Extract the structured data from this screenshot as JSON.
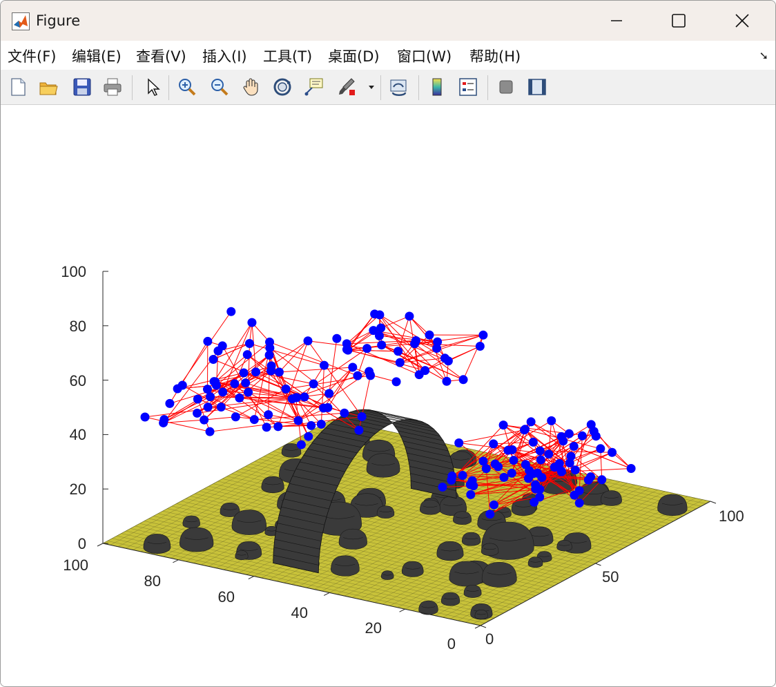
{
  "window": {
    "title": "Figure"
  },
  "menu": [
    {
      "label": "文件(F)",
      "name": "menu-file"
    },
    {
      "label": "编辑(E)",
      "name": "menu-edit"
    },
    {
      "label": "查看(V)",
      "name": "menu-view"
    },
    {
      "label": "插入(I)",
      "name": "menu-insert"
    },
    {
      "label": "工具(T)",
      "name": "menu-tools"
    },
    {
      "label": "桌面(D)",
      "name": "menu-desktop"
    },
    {
      "label": "窗口(W)",
      "name": "menu-window"
    },
    {
      "label": "帮助(H)",
      "name": "menu-help"
    }
  ],
  "toolbar": [
    "new-figure-icon",
    "open-folder-icon",
    "save-icon",
    "print-icon",
    "pointer-icon",
    "zoom-in-icon",
    "zoom-out-icon",
    "pan-hand-icon",
    "rotate-3d-icon",
    "data-cursor-icon",
    "brush-icon",
    "brush-dropdown-icon",
    "link-plot-icon",
    "colorbar-icon",
    "legend-icon",
    "hide-plot-tools-icon",
    "show-plot-tools-icon"
  ],
  "plot": {
    "z_ticks": [
      "0",
      "20",
      "40",
      "60",
      "80",
      "100"
    ],
    "y_ticks": [
      "100",
      "80",
      "60",
      "40",
      "20",
      "0"
    ],
    "x_ticks": [
      "0",
      "50",
      "100"
    ],
    "colors": {
      "ground": "#c8c23a",
      "obstacle": "#3a3a3a",
      "edge": "#ff0000",
      "node": "#0000ff"
    }
  }
}
